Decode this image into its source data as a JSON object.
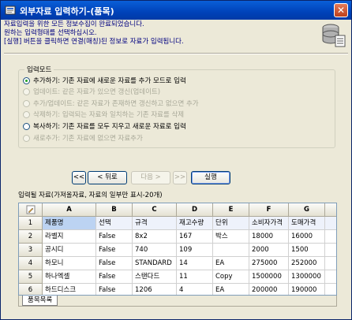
{
  "window": {
    "title": "외부자료 입력하기-(품목)",
    "close_glyph": "✕"
  },
  "info": {
    "line1": "자료입력을 위한 모든 정보수집이 완료되었습니다.",
    "line2": "원하는 입력형태를 선택하십시오.",
    "line3": "[실행] 버튼을 클릭하면 연결(매칭)된 정보로 자료가 입력됩니다."
  },
  "mode": {
    "label": "입력모드",
    "options": [
      {
        "label": "추가하기: 기존 자료에 새로운 자료를 추가 모드로 입력",
        "checked": true,
        "enabled": true
      },
      {
        "label": "업데이트: 같은 자료가 있으면 갱신(업데이트)",
        "checked": false,
        "enabled": false
      },
      {
        "label": "추가/업데이트: 같은 자료가 존재하면 갱신하고 없으면 추가",
        "checked": false,
        "enabled": false
      },
      {
        "label": "삭제하기: 입력되는 자료와 일치하는 기존 자료를 삭제",
        "checked": false,
        "enabled": false
      },
      {
        "label": "복사하기: 기존 자료를 모두 지우고 새로운 자료로 입력",
        "checked": false,
        "enabled": true
      },
      {
        "label": "새로추가: 기존 자료에 없으면 자료추가",
        "checked": false,
        "enabled": false
      }
    ]
  },
  "buttons": {
    "first": "<<",
    "back": "< 뒤로",
    "next": "다음 >",
    "last": ">>",
    "run": "실행"
  },
  "grid": {
    "caption": "입력될 자료(가져올자료, 자료의 일부만 표시-20개)",
    "columns": [
      "A",
      "B",
      "C",
      "D",
      "E",
      "F",
      "G"
    ],
    "rows": [
      {
        "num": "1",
        "cells": [
          "제품명",
          "선택",
          "규격",
          "재고수량",
          "단위",
          "소비자가격",
          "도매가격"
        ]
      },
      {
        "num": "2",
        "cells": [
          "라벨지",
          "False",
          "8x2",
          "167",
          "박스",
          "18000",
          "16000"
        ]
      },
      {
        "num": "3",
        "cells": [
          "공시디",
          "False",
          "740",
          "109",
          "",
          "2000",
          "1500"
        ]
      },
      {
        "num": "4",
        "cells": [
          "하모니",
          "False",
          "STANDARD",
          "14",
          "EA",
          "275000",
          "252000"
        ]
      },
      {
        "num": "5",
        "cells": [
          "하나엑셀",
          "False",
          "스탠다드",
          "11",
          "Copy",
          "1500000",
          "1300000"
        ]
      },
      {
        "num": "6",
        "cells": [
          "하드디스크",
          "False",
          "1206",
          "4",
          "EA",
          "200000",
          "190000"
        ]
      }
    ],
    "sheet_tab": "품목목록"
  }
}
